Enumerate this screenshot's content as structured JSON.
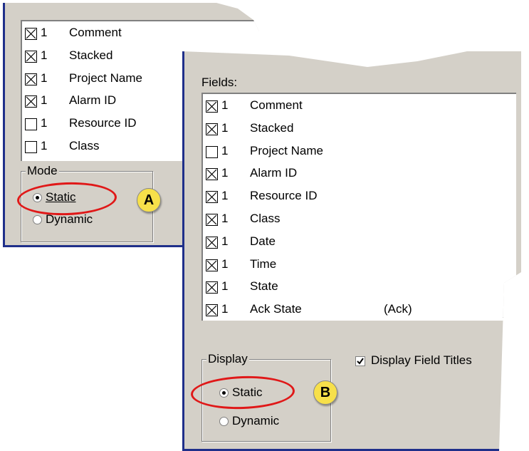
{
  "panel_a": {
    "fields": [
      {
        "checked": true,
        "count": "1",
        "name": "Comment"
      },
      {
        "checked": true,
        "count": "1",
        "name": "Stacked"
      },
      {
        "checked": true,
        "count": "1",
        "name": "Project Name"
      },
      {
        "checked": true,
        "count": "1",
        "name": "Alarm ID"
      },
      {
        "checked": false,
        "count": "1",
        "name": "Resource ID"
      },
      {
        "checked": false,
        "count": "1",
        "name": "Class"
      }
    ],
    "group_title": "Mode",
    "options": [
      {
        "label": "Static",
        "selected": true
      },
      {
        "label": "Dynamic",
        "selected": false
      }
    ],
    "callout": "A"
  },
  "panel_b": {
    "fields_label": "Fields:",
    "fields": [
      {
        "checked": true,
        "count": "1",
        "name": "Comment",
        "extra": ""
      },
      {
        "checked": true,
        "count": "1",
        "name": "Stacked",
        "extra": ""
      },
      {
        "checked": false,
        "count": "1",
        "name": "Project Name",
        "extra": ""
      },
      {
        "checked": true,
        "count": "1",
        "name": "Alarm ID",
        "extra": ""
      },
      {
        "checked": true,
        "count": "1",
        "name": "Resource ID",
        "extra": ""
      },
      {
        "checked": true,
        "count": "1",
        "name": "Class",
        "extra": ""
      },
      {
        "checked": true,
        "count": "1",
        "name": "Date",
        "extra": ""
      },
      {
        "checked": true,
        "count": "1",
        "name": "Time",
        "extra": ""
      },
      {
        "checked": true,
        "count": "1",
        "name": "State",
        "extra": ""
      },
      {
        "checked": true,
        "count": "1",
        "name": "Ack State",
        "extra": "(Ack)"
      }
    ],
    "group_title": "Display",
    "options": [
      {
        "label": "Static",
        "selected": true
      },
      {
        "label": "Dynamic",
        "selected": false
      }
    ],
    "display_field_titles": {
      "label": "Display Field Titles",
      "checked": true
    },
    "callout": "B"
  },
  "colors": {
    "panel_bg": "#d4d0c8",
    "border_accent": "#1f2f8a",
    "highlight": "#e01818",
    "callout": "#f7e04a"
  }
}
